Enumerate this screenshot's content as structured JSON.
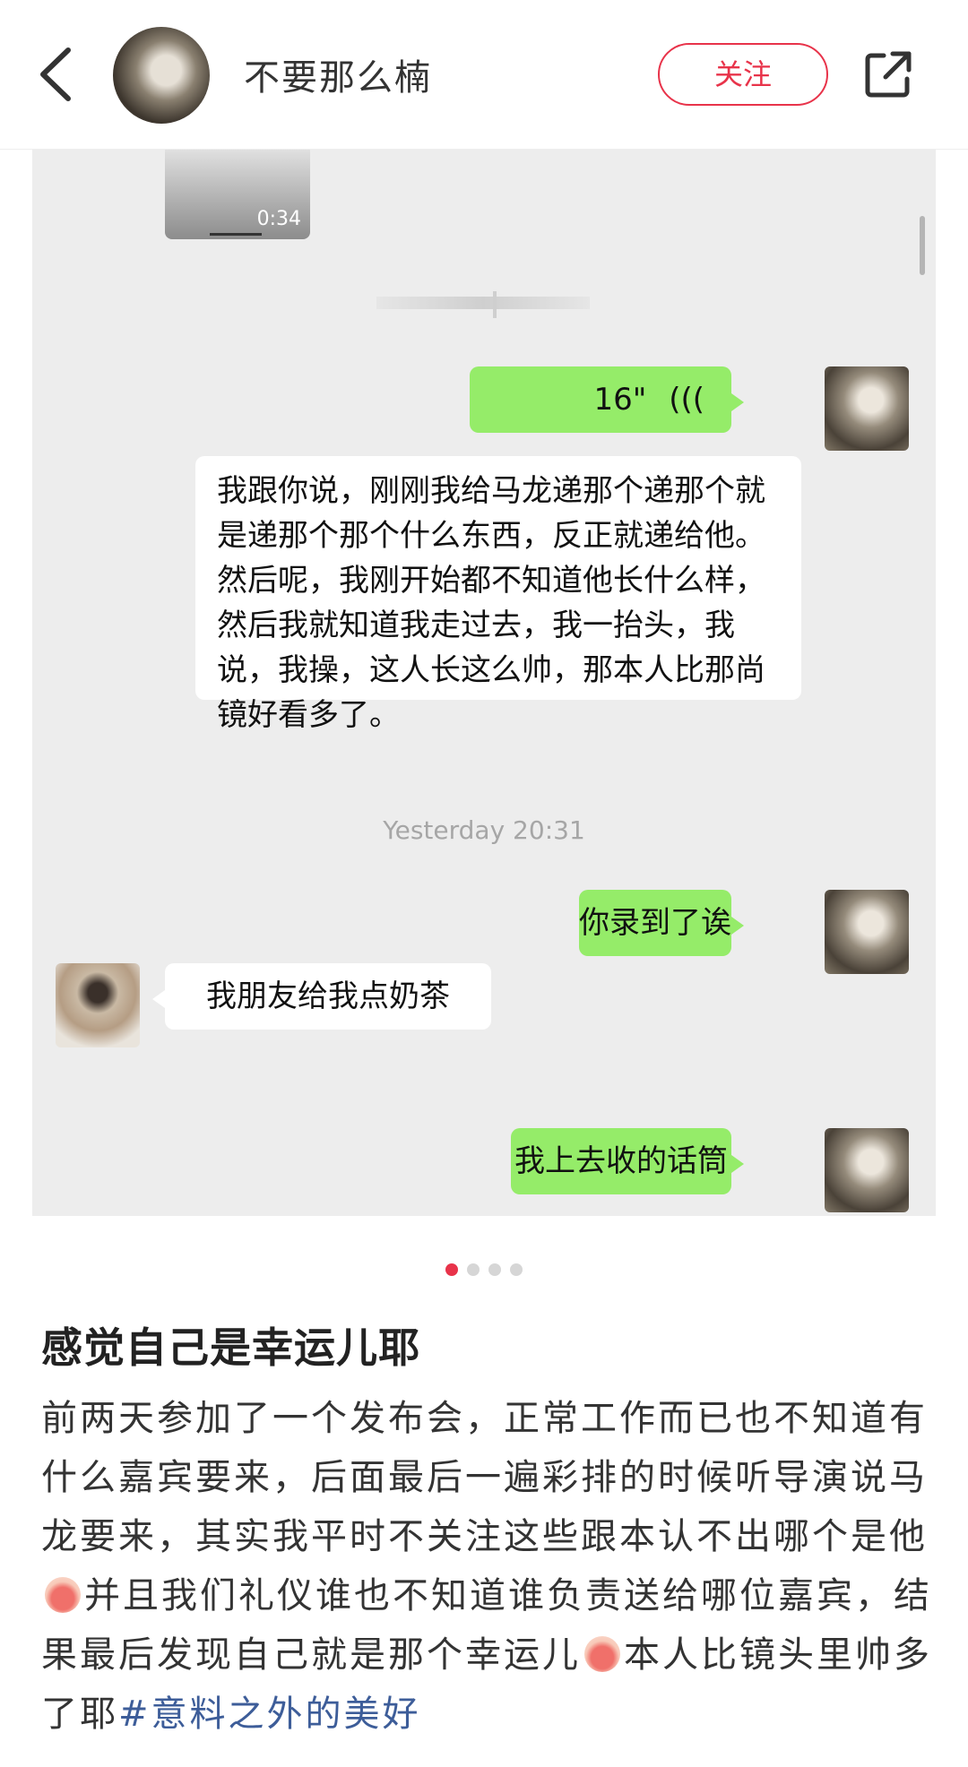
{
  "header": {
    "author_name": "不要那么楠",
    "follow_label": "关注"
  },
  "chat": {
    "video_duration": "0:34",
    "voice_duration": "16\"",
    "voice_text": "我跟你说，刚刚我给马龙递那个递那个就是递那个那个什么东西，反正就递给他。然后呢，我刚开始都不知道他长什么样，然后我就知道我走过去，我一抬头，我说，我操，这人长这么帅，那本人比那尚镜好看多了。",
    "timestamp": "Yesterday 20:31",
    "messages": [
      {
        "side": "right",
        "text": "你录到了诶"
      },
      {
        "side": "left",
        "text": "我朋友给我点奶茶"
      },
      {
        "side": "right",
        "text": "我上去收的话筒"
      }
    ]
  },
  "carousel": {
    "count": 4,
    "active": 0
  },
  "post": {
    "title": "感觉自己是幸运儿耶",
    "body_part1": "前两天参加了一个发布会，正常工作而已也不知道有什么嘉宾要来，后面最后一遍彩排的时候听导演说马龙要来，其实我平时不关注这些跟本认不出哪个是他",
    "body_part2": "并且我们礼仪谁也不知道谁负责送给哪位嘉宾，结果最后发现自己就是那个幸运儿",
    "body_part3": "本人比镜头里帅多了耶",
    "hashtag": "#意料之外的美好"
  },
  "colors": {
    "accent": "#e8334a",
    "bubble_green": "#95ec69",
    "hashtag": "#3d5d99"
  }
}
